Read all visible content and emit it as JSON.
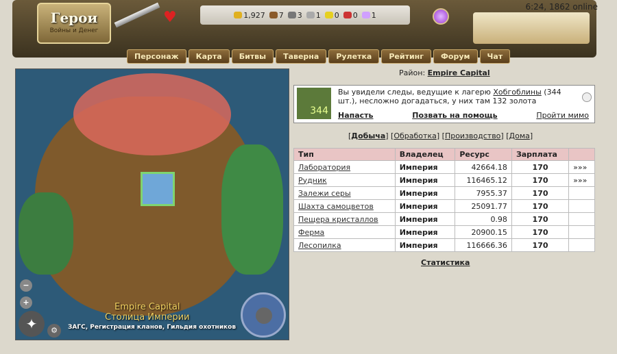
{
  "header": {
    "logo_big": "Герои",
    "logo_small": "Войны и Денег",
    "clock": "6:24, 1862 online"
  },
  "resources": [
    {
      "icon": "gold-icon",
      "value": "1,927",
      "color": "#e0b020"
    },
    {
      "icon": "wood-icon",
      "value": "7",
      "color": "#8a5a2a"
    },
    {
      "icon": "ore-icon",
      "value": "3",
      "color": "#777777"
    },
    {
      "icon": "mercury-icon",
      "value": "1",
      "color": "#aaaaaa"
    },
    {
      "icon": "sulfur-icon",
      "value": "0",
      "color": "#e6d020"
    },
    {
      "icon": "crystal-icon",
      "value": "0",
      "color": "#cc3333"
    },
    {
      "icon": "gems-icon",
      "value": "1",
      "color": "#d0a0ff"
    }
  ],
  "nav": [
    "Персонаж",
    "Карта",
    "Битвы",
    "Таверна",
    "Рулетка",
    "Рейтинг",
    "Форум",
    "Чат"
  ],
  "map": {
    "title_line1": "Empire Capital",
    "title_line2": "Столица Империи",
    "desc": "ЗАГС, Регистрация кланов, Гильдия охотников"
  },
  "district": {
    "label": "Район:",
    "name": "Empire Capital"
  },
  "event": {
    "count_badge": "344",
    "text_before": "Вы увидели следы, ведущие к лагерю ",
    "link": "Хобгоблины",
    "text_after": " (344 шт.), несложно догадаться, у них там 132 золота",
    "attack": "Напасть",
    "call_help": "Позвать на помощь",
    "pass_by": "Пройти мимо"
  },
  "tabs": [
    "Добыча",
    "Обработка",
    "Производство",
    "Дома"
  ],
  "table": {
    "headers": [
      "Тип",
      "Владелец",
      "Ресурс",
      "Зарплата",
      ""
    ],
    "rows": [
      {
        "name": "Лаборатория",
        "owner": "Империя",
        "resource": "42664.18",
        "salary": "170",
        "extra": "»»»"
      },
      {
        "name": "Рудник",
        "owner": "Империя",
        "resource": "116465.12",
        "salary": "170",
        "extra": "»»»"
      },
      {
        "name": "Залежи серы",
        "owner": "Империя",
        "resource": "7955.37",
        "salary": "170",
        "extra": ""
      },
      {
        "name": "Шахта самоцветов",
        "owner": "Империя",
        "resource": "25091.77",
        "salary": "170",
        "extra": ""
      },
      {
        "name": "Пещера кристаллов",
        "owner": "Империя",
        "resource": "0.98",
        "salary": "170",
        "extra": ""
      },
      {
        "name": "Ферма",
        "owner": "Империя",
        "resource": "20900.15",
        "salary": "170",
        "extra": ""
      },
      {
        "name": "Лесопилка",
        "owner": "Империя",
        "resource": "116666.36",
        "salary": "170",
        "extra": ""
      }
    ]
  },
  "stats_link": "Статистика"
}
